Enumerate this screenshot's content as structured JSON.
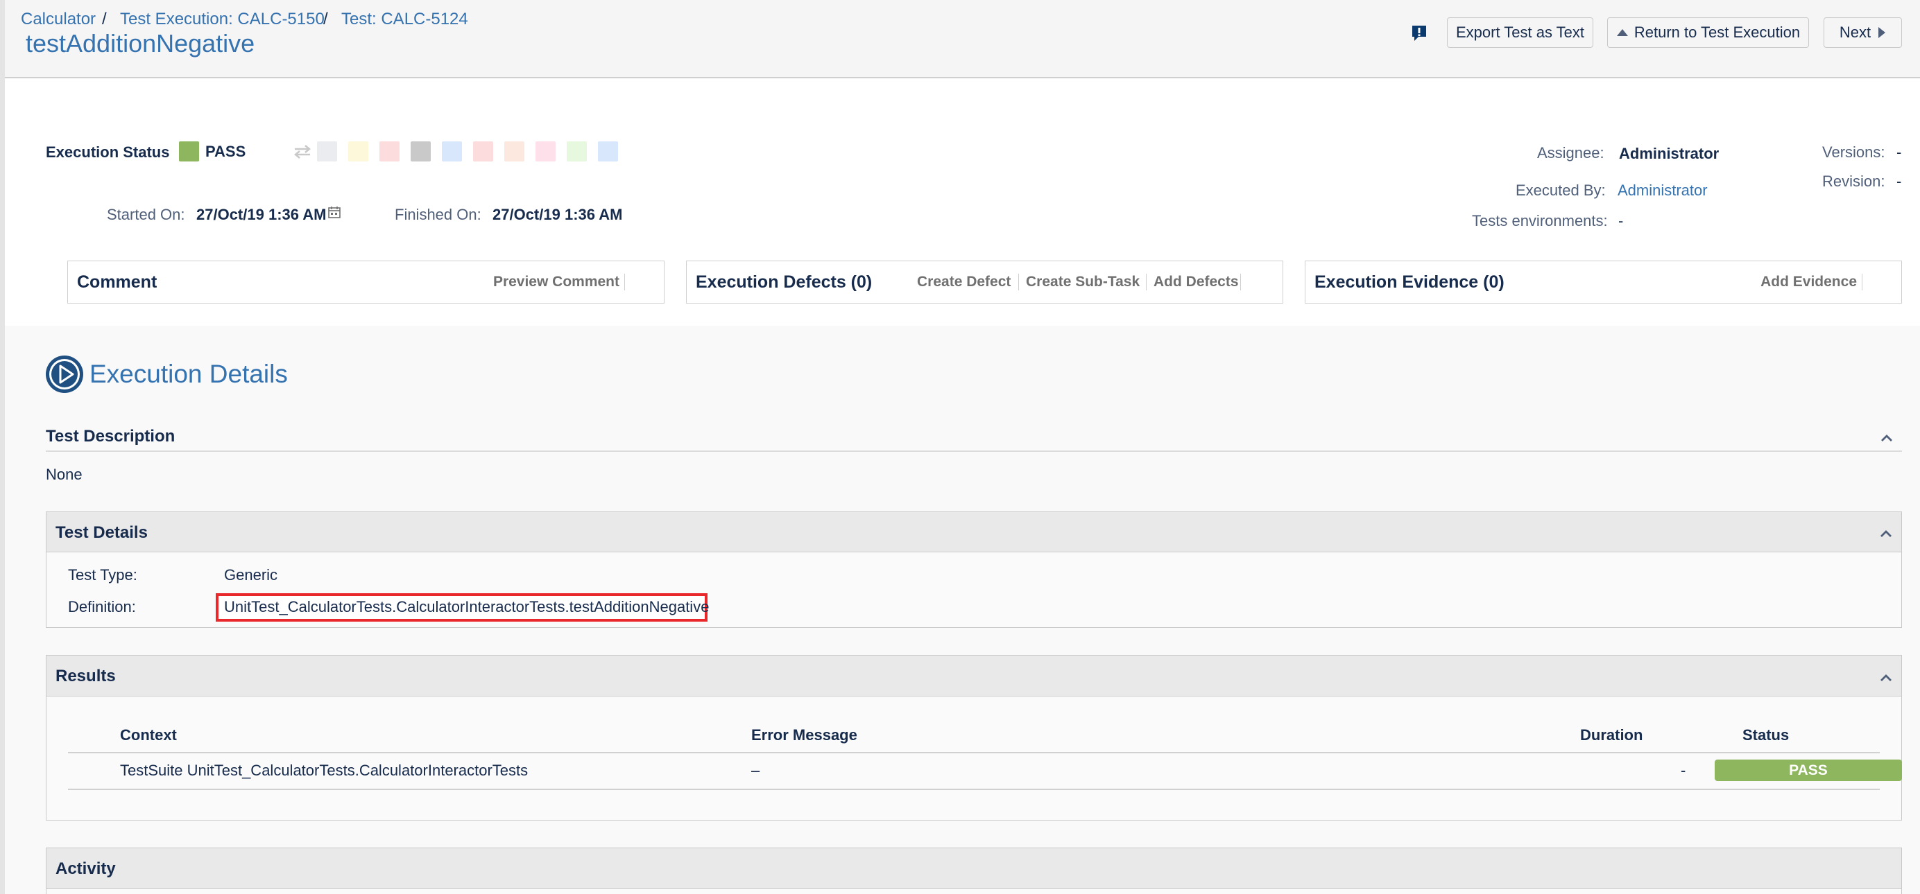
{
  "breadcrumbs": [
    {
      "label": "Calculator"
    },
    {
      "label": "Test Execution: CALC-5150"
    },
    {
      "label": "Test: CALC-5124"
    }
  ],
  "breadcrumb_separator": "/",
  "page_title": "testAdditionNegative",
  "header_buttons": {
    "export": "Export Test as Text",
    "return": "Return to Test Execution",
    "next": "Next"
  },
  "execution": {
    "status_label": "Execution Status",
    "status_value": "PASS",
    "status_color": "#8eb65e",
    "started_label": "Started On:",
    "started_value": "27/Oct/19 1:36 AM",
    "finished_label": "Finished On:",
    "finished_value": "27/Oct/19 1:36 AM",
    "status_swatches": [
      "#ebecf0",
      "#fdf8d9",
      "#fcdcdc",
      "#c9c9c9",
      "#d9e7fd",
      "#fcdcdc",
      "#fde8e0",
      "#fde0ea",
      "#e6f9df",
      "#d9e7fd"
    ]
  },
  "people": {
    "assignee_label": "Assignee:",
    "assignee_value": "Administrator",
    "executed_by_label": "Executed By:",
    "executed_by_value": "Administrator",
    "environments_label": "Tests environments:",
    "environments_value": "-",
    "versions_label": "Versions:",
    "versions_value": "-",
    "revision_label": "Revision:",
    "revision_value": "-"
  },
  "modules": {
    "comment": {
      "title": "Comment",
      "links": [
        "Preview Comment"
      ]
    },
    "defects": {
      "title": "Execution Defects (0)",
      "links": [
        "Create Defect",
        "Create Sub-Task",
        "Add Defects"
      ]
    },
    "evidence": {
      "title": "Execution Evidence (0)",
      "links": [
        "Add Evidence"
      ]
    }
  },
  "details": {
    "heading": "Execution Details",
    "description_title": "Test Description",
    "description_value": "None",
    "test_details_title": "Test Details",
    "type_label": "Test Type:",
    "type_value": "Generic",
    "definition_label": "Definition:",
    "definition_value": "UnitTest_CalculatorTests.CalculatorInteractorTests.testAdditionNegative"
  },
  "results": {
    "title": "Results",
    "columns": [
      "Context",
      "Error Message",
      "Duration",
      "Status"
    ],
    "rows": [
      {
        "context": "TestSuite UnitTest_CalculatorTests.CalculatorInteractorTests",
        "error": "–",
        "duration": "-",
        "status": "PASS"
      }
    ]
  },
  "activity": {
    "title": "Activity"
  }
}
